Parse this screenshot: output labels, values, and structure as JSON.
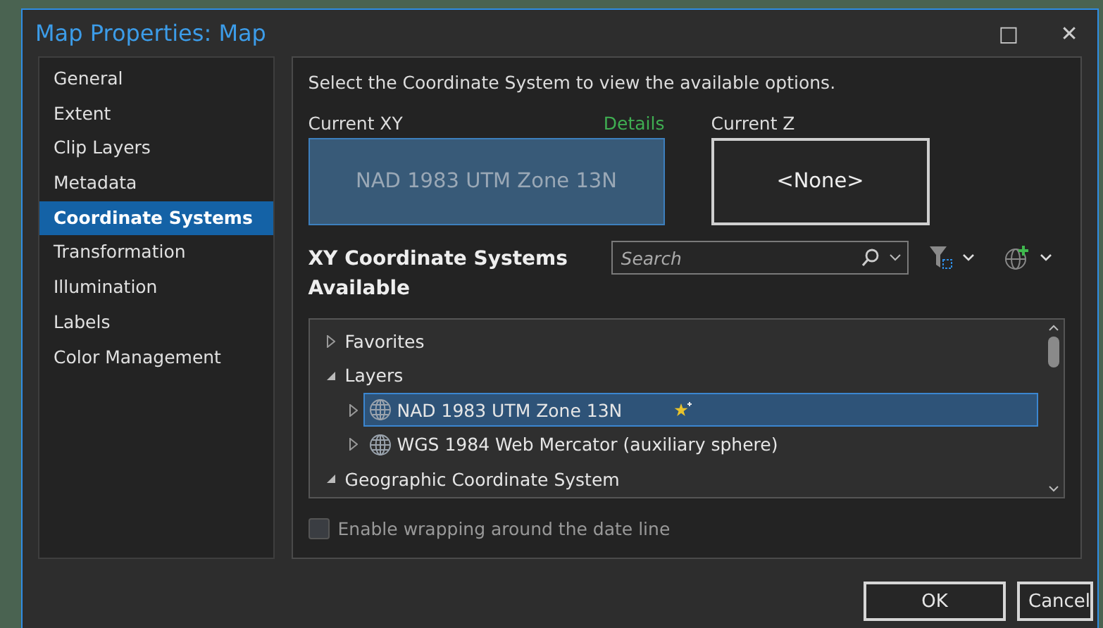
{
  "window": {
    "title": "Map Properties: Map",
    "controls": [
      "□",
      "✕"
    ]
  },
  "sidebar": {
    "items": [
      {
        "label": "General",
        "selected": false
      },
      {
        "label": "Extent",
        "selected": false
      },
      {
        "label": "Clip Layers",
        "selected": false
      },
      {
        "label": "Metadata",
        "selected": false
      },
      {
        "label": "Coordinate Systems",
        "selected": true
      },
      {
        "label": "Transformation",
        "selected": false
      },
      {
        "label": "Illumination",
        "selected": false
      },
      {
        "label": "Labels",
        "selected": false
      },
      {
        "label": "Color Management",
        "selected": false
      }
    ]
  },
  "panel": {
    "instruction": "Select the Coordinate System to view the available options.",
    "current_xy": {
      "label": "Current XY",
      "link": "Details",
      "value": "NAD 1983 UTM Zone 13N"
    },
    "current_z": {
      "label": "Current Z",
      "value": "<None>"
    },
    "heading": "XY Coordinate Systems Available",
    "search": {
      "placeholder": "Search"
    },
    "tree": [
      {
        "label": "Favorites",
        "kind": "folder",
        "expanded": false,
        "selected": false
      },
      {
        "label": "Layers",
        "kind": "folder",
        "expanded": true,
        "selected": false,
        "children": [
          {
            "label": "NAD 1983 UTM Zone 13N",
            "kind": "system",
            "expanded": false,
            "selected": true,
            "favorite": true
          },
          {
            "label": "WGS 1984 Web Mercator (auxiliary sphere)",
            "kind": "system",
            "expanded": false,
            "selected": false,
            "favorite": false
          }
        ]
      },
      {
        "label": "Geographic Coordinate System",
        "kind": "folder",
        "expanded": true,
        "selected": false
      }
    ],
    "wrap_option": {
      "label": "Enable wrapping around the date line",
      "checked": false
    }
  },
  "buttons": [
    "OK",
    "Cancel"
  ]
}
